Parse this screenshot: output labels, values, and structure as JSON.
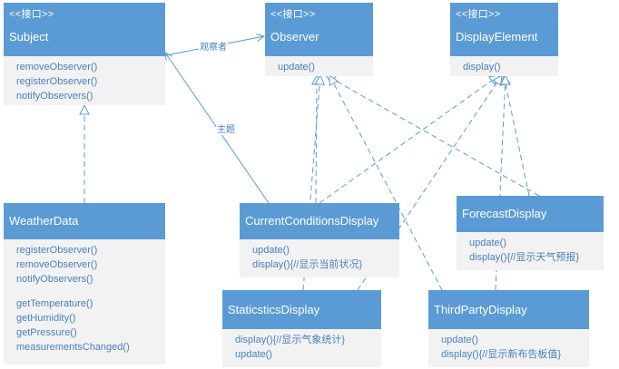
{
  "classes": {
    "subject": {
      "stereotype": "<<接口>>",
      "name": "Subject",
      "methods": [
        "removeObserver()",
        "registerObserver()",
        "notifyObservers()"
      ]
    },
    "observer": {
      "stereotype": "<<接口>>",
      "name": "Observer",
      "methods": [
        "update()"
      ]
    },
    "display_element": {
      "stereotype": "<<接口>>",
      "name": "DisplayElement",
      "methods": [
        "display()"
      ]
    },
    "weather_data": {
      "name": "WeatherData",
      "methods_group1": [
        "registerObserver()",
        "removeObserver()",
        "notifyObservers()"
      ],
      "methods_group2": [
        "getTemperature()",
        "getHumidity()",
        "getPressure()",
        "measurementsChanged()"
      ]
    },
    "current_conditions": {
      "name": "CurrentConditionsDisplay",
      "methods": [
        "update()",
        "display(){//显示当前状况}"
      ]
    },
    "forecast": {
      "name": "ForecastDisplay",
      "methods": [
        "update()",
        "display(){//显示天气预报}"
      ]
    },
    "statistics": {
      "name": "StaticsticsDisplay",
      "methods": [
        "display(){//显示气象统计}",
        "update()"
      ]
    },
    "third_party": {
      "name": "ThirdPartyDisplay",
      "methods": [
        "update()",
        "display(){//显示新布告板值}"
      ]
    }
  },
  "edge_labels": {
    "observers": "观察者",
    "subject": "主题"
  },
  "colors": {
    "header": "#5b9bd5",
    "body": "#f2f2f2",
    "text": "#4a7fc1",
    "line": "#5b9bd5"
  }
}
